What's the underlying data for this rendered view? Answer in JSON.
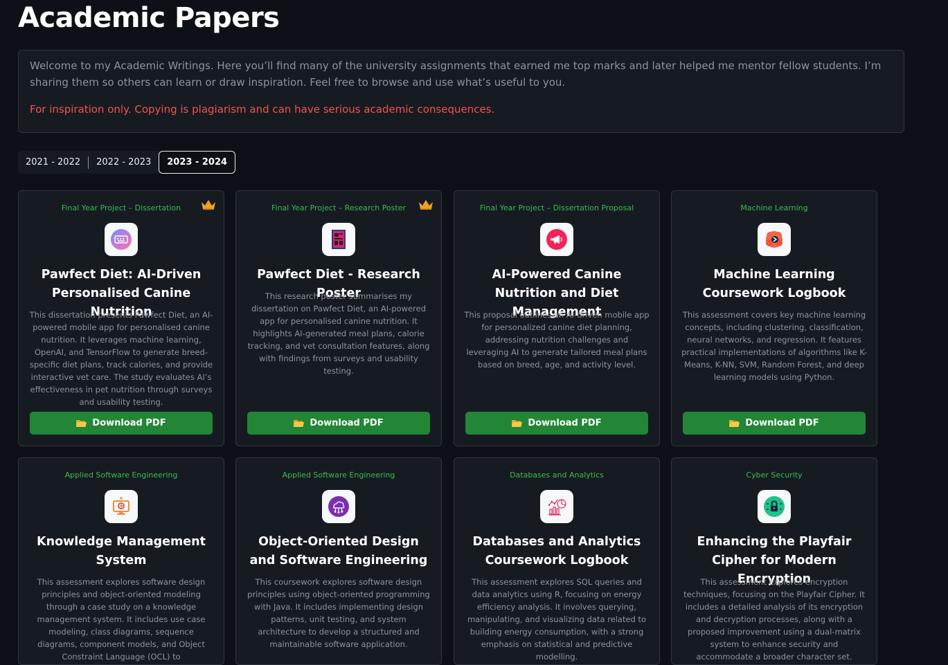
{
  "page": {
    "title": "Academic Papers"
  },
  "intro": {
    "text": "Welcome to my Academic Writings. Here you’ll find many of the university assignments that earned me top marks and later helped me mentor fellow students. I’m sharing them so others can learn or draw inspiration. Feel free to browse and use what’s useful to you.",
    "warning": "For inspiration only. Copying is plagiarism and can have serious academic consequences."
  },
  "year_tabs": [
    {
      "label": "2021 - 2022",
      "active": false
    },
    {
      "label": "2022 - 2023",
      "active": false
    },
    {
      "label": "2023 - 2024",
      "active": true
    }
  ],
  "colors": {
    "background": "#0d1117",
    "card": "#161b22",
    "accent_green": "#238636",
    "category_green": "#3fb950",
    "warning_red": "#f85149",
    "crown": "#f0a020"
  },
  "cards": [
    {
      "category": "Final Year Project – Dissertation",
      "featured": true,
      "icon": "keyboard-icon",
      "title": "Pawfect Diet: AI-Driven Personalised Canine Nutrition",
      "description": "This dissertation presents Pawfect Diet, an AI-powered mobile app for personalised canine nutrition. It leverages machine learning, OpenAI, and TensorFlow to generate breed-specific diet plans, track calories, and provide interactive vet care. The study evaluates AI’s effectiveness in pet nutrition through surveys and usability testing.",
      "button": "Download PDF"
    },
    {
      "category": "Final Year Project – Research Poster",
      "featured": true,
      "icon": "poster-icon",
      "title": "Pawfect Diet - Research Poster",
      "description": "This research poster summarises my dissertation on Pawfect Diet, an AI-powered app for personalised canine nutrition. It highlights AI-generated meal plans, calorie tracking, and vet consultation features, along with findings from surveys and usability testing.",
      "button": "Download PDF"
    },
    {
      "category": "Final Year Project – Dissertation Proposal",
      "featured": false,
      "icon": "megaphone-icon",
      "title": "AI-Powered Canine Nutrition and Diet Management",
      "description": "This proposal outlines an AI-driven mobile app for personalized canine diet planning, addressing nutrition challenges and leveraging AI to generate tailored meal plans based on breed, age, and activity level.",
      "button": "Download PDF"
    },
    {
      "category": "Machine Learning",
      "featured": false,
      "icon": "brain-icon",
      "title": "Machine Learning Coursework Logbook",
      "description": "This assessment covers key machine learning concepts, including clustering, classification, neural networks, and regression. It features practical implementations of algorithms like K-Means, K-NN, SVM, Random Forest, and deep learning models using Python.",
      "button": "Download PDF"
    },
    {
      "category": "Applied Software Engineering",
      "featured": false,
      "icon": "monitor-gear-icon",
      "title": "Knowledge Management System",
      "description": "This assessment explores software design principles and object-oriented modeling through a case study on a knowledge management system. It includes use case modeling, class diagrams, sequence diagrams, component models, and Object Constraint Language (OCL) to",
      "button": ""
    },
    {
      "category": "Applied Software Engineering",
      "featured": false,
      "icon": "cloud-network-icon",
      "title": "Object-Oriented Design and Software Engineering",
      "description": "This coursework explores software design principles using object-oriented programming with Java. It includes implementing design patterns, unit testing, and system architecture to develop a structured and maintainable software application.",
      "button": ""
    },
    {
      "category": "Databases and Analytics",
      "featured": false,
      "icon": "analytics-icon",
      "title": "Databases and Analytics Coursework Logbook",
      "description": "This assessment explores SQL queries and data analytics using R, focusing on energy efficiency analysis. It involves querying, manipulating, and visualizing data related to building energy consumption, with a strong emphasis on statistical and predictive modelling.",
      "button": ""
    },
    {
      "category": "Cyber Security",
      "featured": false,
      "icon": "lock-icon",
      "title": "Enhancing the Playfair Cipher for Modern Encryption",
      "description": "This assessment explores encryption techniques, focusing on the Playfair Cipher. It includes a detailed analysis of its encryption and decryption processes, along with a proposed improvement using a dual-matrix system to enhance security and accommodate a broader character set.",
      "button": ""
    }
  ]
}
